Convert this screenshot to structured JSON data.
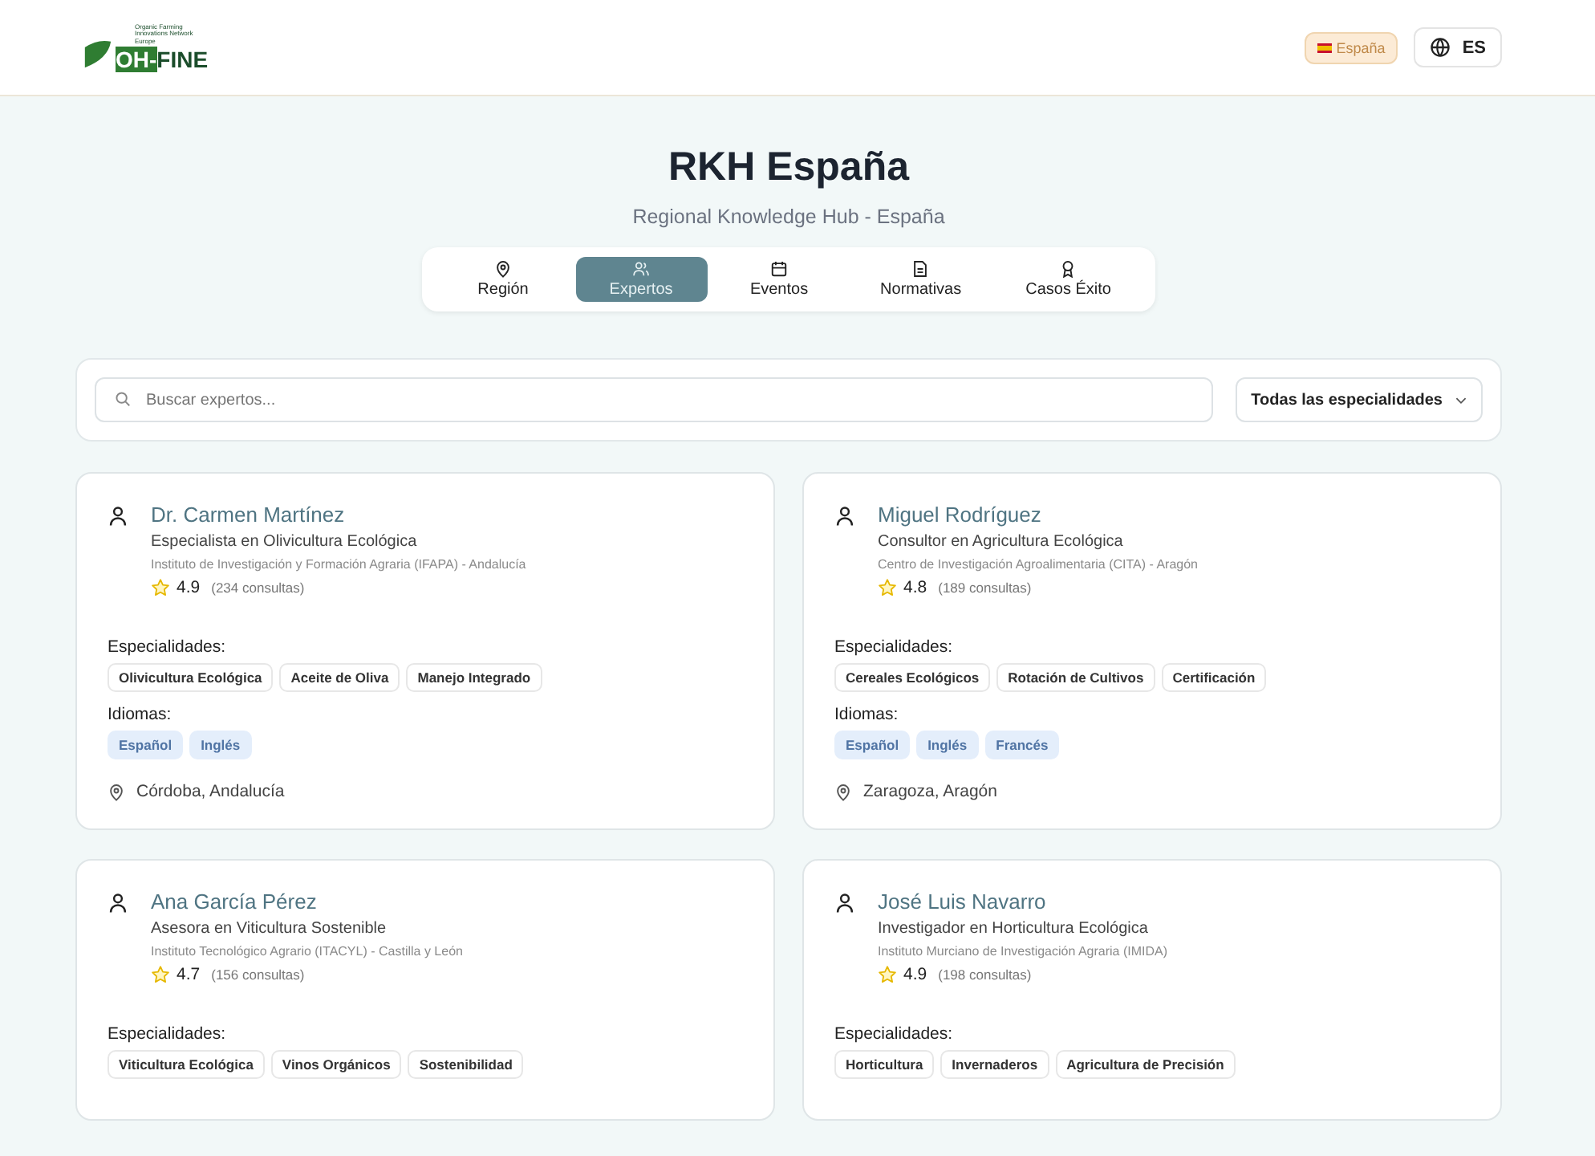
{
  "header": {
    "logo": {
      "tagline": "Organic Farming Innovations Network Europe",
      "mark": "OH-",
      "name": "FINE"
    },
    "region_badge": "España",
    "language": "ES"
  },
  "hero": {
    "title": "RKH España",
    "subtitle": "Regional Knowledge Hub - España"
  },
  "tabs": [
    {
      "label": "Región",
      "kind": "pin",
      "selected": false
    },
    {
      "label": "Expertos",
      "kind": "users",
      "selected": true
    },
    {
      "label": "Eventos",
      "kind": "calendar",
      "selected": false
    },
    {
      "label": "Normativas",
      "kind": "file",
      "selected": false
    },
    {
      "label": "Casos Éxito",
      "kind": "award",
      "selected": false
    }
  ],
  "search": {
    "placeholder": "Buscar expertos...",
    "filter": "Todas las especialidades"
  },
  "experts": [
    {
      "name": "Dr. Carmen Martínez",
      "role": "Especialista en Olivicultura Ecológica",
      "institution": "Instituto de Investigación y Formación Agraria (IFAPA) - Andalucía",
      "rating": "4.9",
      "consultations": "(234 consultas)",
      "specialties_label": "Especialidades:",
      "specialties": [
        "Olivicultura Ecológica",
        "Aceite de Oliva",
        "Manejo Integrado"
      ],
      "languages_label": "Idiomas:",
      "languages": [
        "Español",
        "Inglés"
      ],
      "location": "Córdoba, Andalucía"
    },
    {
      "name": "Miguel Rodríguez",
      "role": "Consultor en Agricultura Ecológica",
      "institution": "Centro de Investigación Agroalimentaria (CITA) - Aragón",
      "rating": "4.8",
      "consultations": "(189 consultas)",
      "specialties_label": "Especialidades:",
      "specialties": [
        "Cereales Ecológicos",
        "Rotación de Cultivos",
        "Certificación"
      ],
      "languages_label": "Idiomas:",
      "languages": [
        "Español",
        "Inglés",
        "Francés"
      ],
      "location": "Zaragoza, Aragón"
    },
    {
      "name": "Ana García Pérez",
      "role": "Asesora en Viticultura Sostenible",
      "institution": "Instituto Tecnológico Agrario (ITACYL) - Castilla y León",
      "rating": "4.7",
      "consultations": "(156 consultas)",
      "specialties_label": "Especialidades:",
      "specialties": [
        "Viticultura Ecológica",
        "Vinos Orgánicos",
        "Sostenibilidad"
      ]
    },
    {
      "name": "José Luis Navarro",
      "role": "Investigador en Horticultura Ecológica",
      "institution": "Instituto Murciano de Investigación Agraria (IMIDA)",
      "rating": "4.9",
      "consultations": "(198 consultas)",
      "specialties_label": "Especialidades:",
      "specialties": [
        "Horticultura",
        "Invernaderos",
        "Agricultura de Precisión"
      ]
    }
  ]
}
